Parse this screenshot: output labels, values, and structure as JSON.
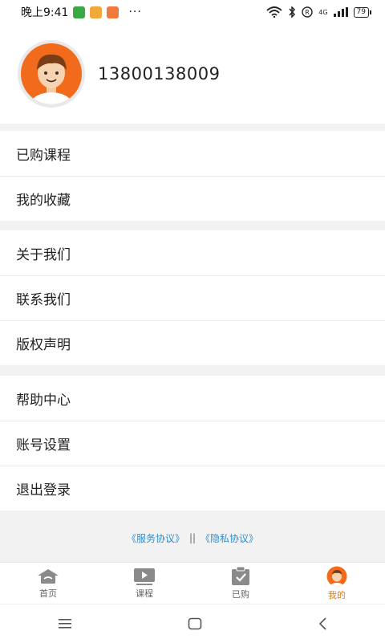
{
  "status": {
    "time": "晚上9:41",
    "dots": "···",
    "network": "4G",
    "battery": "79"
  },
  "profile": {
    "phone": "13800138009"
  },
  "menu_groups": [
    [
      "已购课程",
      "我的收藏"
    ],
    [
      "关于我们",
      "联系我们",
      "版权声明"
    ],
    [
      "帮助中心",
      "账号设置",
      "退出登录"
    ]
  ],
  "footer": {
    "service": "《服务协议》",
    "separator": "||",
    "privacy": "《隐私协议》"
  },
  "tabs": [
    {
      "label": "首页",
      "icon": "home-icon"
    },
    {
      "label": "课程",
      "icon": "play-icon"
    },
    {
      "label": "已购",
      "icon": "clipboard-check-icon"
    },
    {
      "label": "我的",
      "icon": "avatar-icon"
    }
  ],
  "colors": {
    "accent": "#d97a1a",
    "link": "#2e8fd0",
    "avatar_orange": "#f26a1b"
  }
}
